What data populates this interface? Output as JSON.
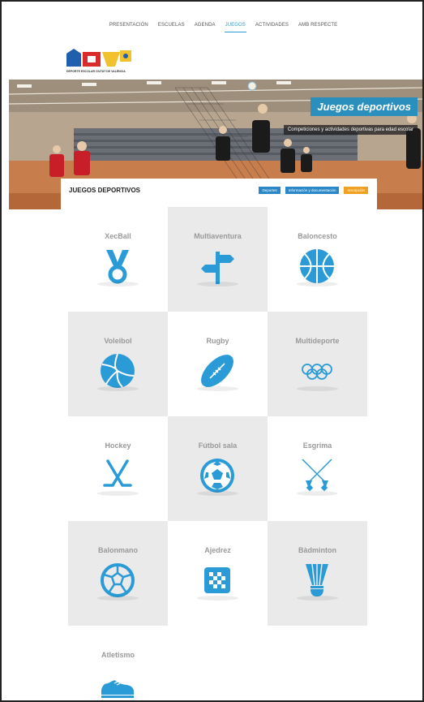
{
  "nav": {
    "items": [
      {
        "label": "PRESENTACIÓN"
      },
      {
        "label": "ESCUELAS"
      },
      {
        "label": "AGENDA"
      },
      {
        "label": "JUEGOS"
      },
      {
        "label": "ACTIVIDADES"
      },
      {
        "label": "AMB RESPECTE"
      }
    ],
    "active_index": 3
  },
  "logo": {
    "caption": "DEPORTE ESCOLAR CIUTAT DE VALÈNCIA"
  },
  "hero": {
    "title": "Juegos deportivos",
    "subtitle": "Competiciones y actividades deportivas para edad escolar"
  },
  "section": {
    "title": "JUEGOS DEPORTIVOS",
    "buttons": [
      {
        "label": "Deportes",
        "color": "#2a88c8"
      },
      {
        "label": "Información y documentación",
        "color": "#2a88c8"
      },
      {
        "label": "Inscripción",
        "color": "#f0a020"
      }
    ]
  },
  "sports": [
    {
      "label": "XecBall",
      "icon": "medal-icon"
    },
    {
      "label": "Multiaventura",
      "icon": "signpost-icon"
    },
    {
      "label": "Baloncesto",
      "icon": "basketball-icon"
    },
    {
      "label": "Voleibol",
      "icon": "volleyball-icon"
    },
    {
      "label": "Rugby",
      "icon": "rugby-ball-icon"
    },
    {
      "label": "Multideporte",
      "icon": "olympic-rings-icon"
    },
    {
      "label": "Hockey",
      "icon": "hockey-sticks-icon"
    },
    {
      "label": "Fútbol sala",
      "icon": "soccer-ball-icon"
    },
    {
      "label": "Esgrima",
      "icon": "fencing-icon"
    },
    {
      "label": "Balonmano",
      "icon": "handball-icon"
    },
    {
      "label": "Ajedrez",
      "icon": "chess-board-icon"
    },
    {
      "label": "Bàdminton",
      "icon": "shuttlecock-icon"
    },
    {
      "label": "Atletismo",
      "icon": "running-shoe-icon"
    }
  ],
  "colors": {
    "accent": "#2a9bd6",
    "icon": "#2a9bd6",
    "tile_grey": "#eaeaea",
    "orange": "#f0a020"
  }
}
